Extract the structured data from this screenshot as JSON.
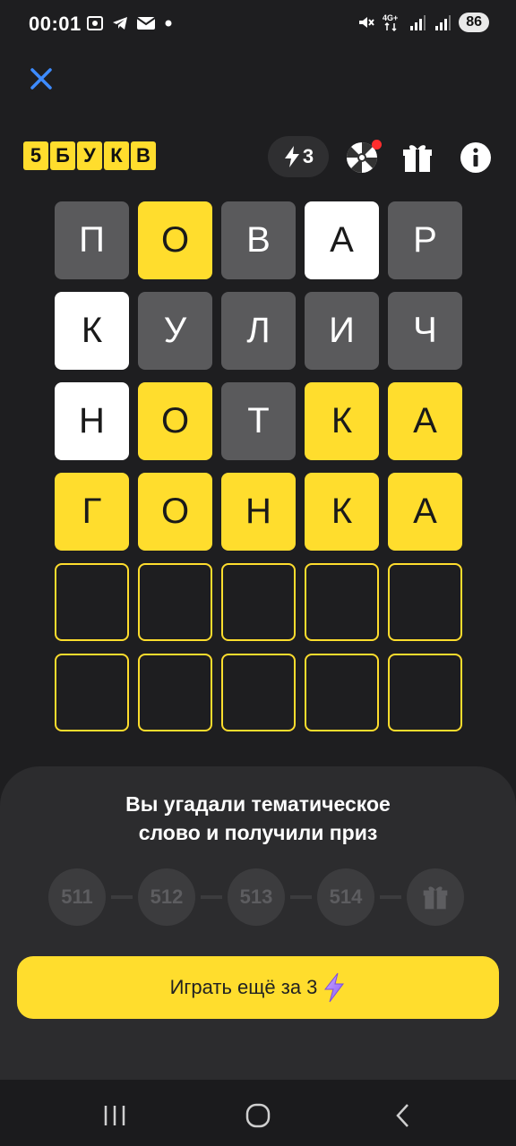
{
  "status_bar": {
    "time": "00:01",
    "left_icons": [
      "screenshot-icon",
      "telegram-icon",
      "mail-icon",
      "dot-icon"
    ],
    "right_icons": [
      "mute-icon",
      "network-4g-icon",
      "signal-icon",
      "signal-icon"
    ],
    "battery": "86"
  },
  "header": {
    "logo_letters": [
      "5",
      "Б",
      "У",
      "К",
      "В"
    ],
    "energy_count": "3",
    "has_notification_dot": true
  },
  "board": {
    "rows": [
      [
        {
          "l": "П",
          "s": "gray"
        },
        {
          "l": "О",
          "s": "yellow"
        },
        {
          "l": "В",
          "s": "gray"
        },
        {
          "l": "А",
          "s": "white"
        },
        {
          "l": "Р",
          "s": "gray"
        }
      ],
      [
        {
          "l": "К",
          "s": "white"
        },
        {
          "l": "У",
          "s": "gray"
        },
        {
          "l": "Л",
          "s": "gray"
        },
        {
          "l": "И",
          "s": "gray"
        },
        {
          "l": "Ч",
          "s": "gray"
        }
      ],
      [
        {
          "l": "Н",
          "s": "white"
        },
        {
          "l": "О",
          "s": "yellow"
        },
        {
          "l": "Т",
          "s": "gray"
        },
        {
          "l": "К",
          "s": "yellow"
        },
        {
          "l": "А",
          "s": "yellow"
        }
      ],
      [
        {
          "l": "Г",
          "s": "yellow"
        },
        {
          "l": "О",
          "s": "yellow"
        },
        {
          "l": "Н",
          "s": "yellow"
        },
        {
          "l": "К",
          "s": "yellow"
        },
        {
          "l": "А",
          "s": "yellow"
        }
      ],
      [
        {
          "l": "",
          "s": "empty"
        },
        {
          "l": "",
          "s": "empty"
        },
        {
          "l": "",
          "s": "empty"
        },
        {
          "l": "",
          "s": "empty"
        },
        {
          "l": "",
          "s": "empty"
        }
      ],
      [
        {
          "l": "",
          "s": "empty"
        },
        {
          "l": "",
          "s": "empty"
        },
        {
          "l": "",
          "s": "empty"
        },
        {
          "l": "",
          "s": "empty"
        },
        {
          "l": "",
          "s": "empty"
        }
      ]
    ]
  },
  "result": {
    "message": "Вы угадали тематическое\nслово и получили приз",
    "steps": [
      "511",
      "512",
      "513",
      "514"
    ],
    "final_step_icon": "gift-icon",
    "play_button": "Играть ещё за 3"
  },
  "colors": {
    "accent": "#ffdd2d",
    "background": "#1e1e20",
    "tile_gray": "#5a5a5c",
    "close_icon": "#3d8bff"
  }
}
